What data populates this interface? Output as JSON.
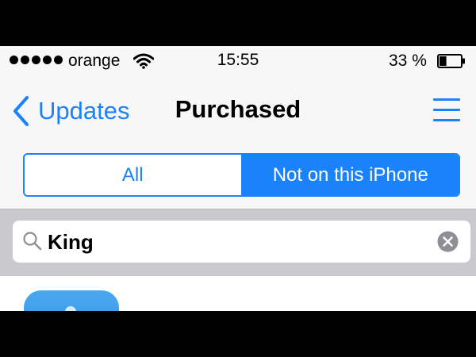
{
  "status_bar": {
    "carrier": "orange",
    "time": "15:55",
    "battery_percent": "33 %",
    "battery_level": 0.33,
    "signal_bars": 5,
    "icons": [
      "signal-dots-icon",
      "wifi-icon",
      "battery-icon"
    ]
  },
  "nav": {
    "back_label": "Updates",
    "title": "Purchased",
    "icons": [
      "chevron-left-icon",
      "menu-icon"
    ]
  },
  "segmented": {
    "options": [
      "All",
      "Not on this iPhone"
    ],
    "selected": "Not on this iPhone"
  },
  "search": {
    "value": "King",
    "icons": [
      "search-icon",
      "clear-icon"
    ]
  },
  "colors": {
    "accent": "#1a82fb",
    "search_bar_bg": "#c9c9ce",
    "app_icon": "#3a9be8"
  }
}
